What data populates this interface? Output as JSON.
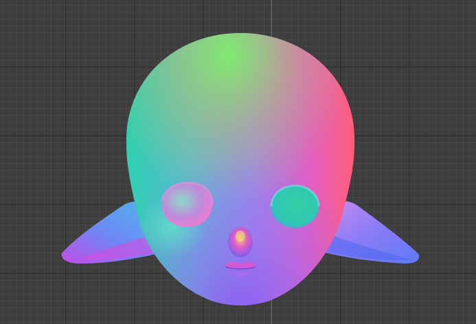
{
  "viewport": {
    "background_color": "#3d3d3d",
    "axis_color": "#3f6fc4",
    "shading": "normal-map"
  },
  "model": {
    "name": "",
    "parts": [
      "head",
      "left-ear",
      "right-ear",
      "left-eye-socket",
      "right-eye-socket",
      "nose",
      "mouth"
    ]
  }
}
